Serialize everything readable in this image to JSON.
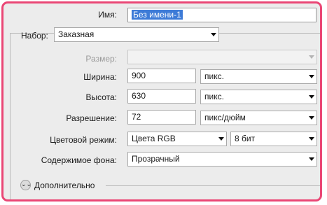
{
  "dialog": {
    "name_label": "Имя:",
    "name_value": "Без имени-1",
    "preset_label": "Набор:",
    "preset_value": "Заказная",
    "size_label": "Размер:",
    "size_value": "",
    "width_label": "Ширина:",
    "width_value": "900",
    "width_unit": "пикс.",
    "height_label": "Высота:",
    "height_value": "630",
    "height_unit": "пикс.",
    "resolution_label": "Разрешение:",
    "resolution_value": "72",
    "resolution_unit": "пикс/дюйм",
    "color_mode_label": "Цветовой режим:",
    "color_mode_value": "Цвета RGB",
    "bit_depth_value": "8 бит",
    "background_label": "Содержимое фона:",
    "background_value": "Прозрачный",
    "advanced_label": "Дополнительно",
    "advanced_icon": "double-chevron-down-icon"
  },
  "colors": {
    "highlight_border": "#ea4675",
    "selection": "#3d7bd7",
    "panel_background": "#ececec"
  }
}
